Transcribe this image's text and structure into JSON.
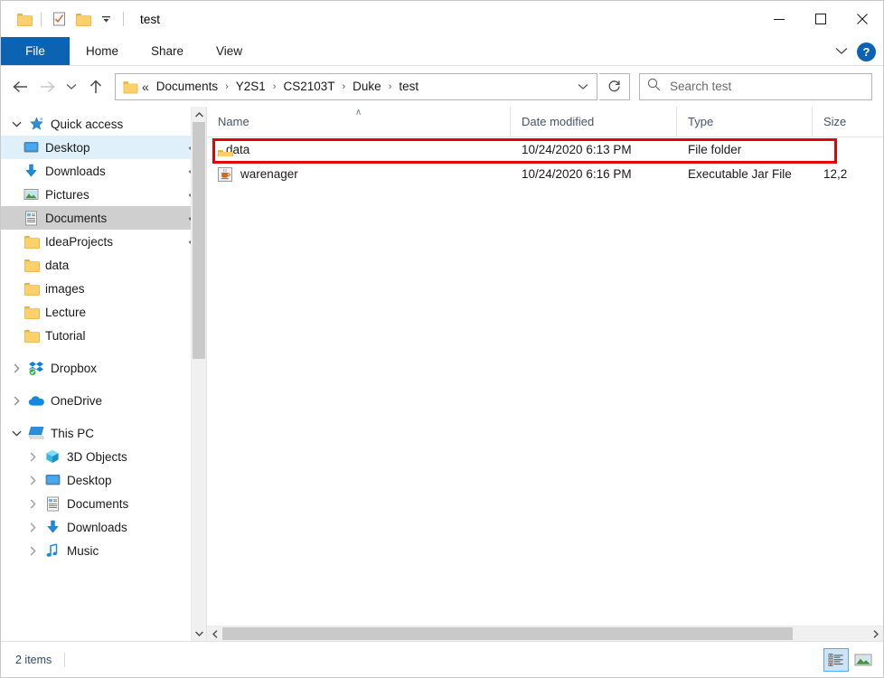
{
  "window": {
    "title": "test",
    "quick_access_toolbar": [
      {
        "name": "folder-icon",
        "label": "Properties folder"
      },
      {
        "name": "properties-icon",
        "label": "Properties"
      },
      {
        "name": "new-folder-icon",
        "label": "New folder"
      },
      {
        "name": "customize-dropdown-icon",
        "label": "Customize Quick Access Toolbar"
      }
    ],
    "controls": {
      "minimize": "─",
      "maximize": "□",
      "close": "✕"
    }
  },
  "ribbon": {
    "tabs": [
      {
        "label": "File",
        "active": true
      },
      {
        "label": "Home",
        "active": false
      },
      {
        "label": "Share",
        "active": false
      },
      {
        "label": "View",
        "active": false
      }
    ],
    "expand_icon": "∨",
    "help_label": "?"
  },
  "navigation": {
    "back": "←",
    "forward": "→",
    "recent": "∨",
    "up": "↑",
    "refresh": "⟳",
    "breadcrumb_prefix": "«",
    "breadcrumb": [
      "Documents",
      "Y2S1",
      "CS2103T",
      "Duke",
      "test"
    ],
    "breadcrumb_separator": "›",
    "breadcrumb_dropdown": "∨"
  },
  "search": {
    "placeholder": "Search test",
    "value": "",
    "icon": "search-icon"
  },
  "sidebar": {
    "groups": [
      {
        "label": "Quick access",
        "icon": "star-pin-icon",
        "expanded": true,
        "chevron": "∨",
        "items": [
          {
            "label": "Desktop",
            "icon": "desktop-icon",
            "pinned": true,
            "state": "hovered"
          },
          {
            "label": "Downloads",
            "icon": "download-icon",
            "pinned": true,
            "state": "normal"
          },
          {
            "label": "Pictures",
            "icon": "pictures-icon",
            "pinned": true,
            "state": "normal"
          },
          {
            "label": "Documents",
            "icon": "documents-icon",
            "pinned": true,
            "state": "selected"
          },
          {
            "label": "IdeaProjects",
            "icon": "folder-icon",
            "pinned": true,
            "state": "normal"
          },
          {
            "label": "data",
            "icon": "folder-icon",
            "pinned": false,
            "state": "normal"
          },
          {
            "label": "images",
            "icon": "folder-icon",
            "pinned": false,
            "state": "normal"
          },
          {
            "label": "Lecture",
            "icon": "folder-icon",
            "pinned": false,
            "state": "normal"
          },
          {
            "label": "Tutorial",
            "icon": "folder-icon",
            "pinned": false,
            "state": "normal"
          }
        ]
      },
      {
        "label": "Dropbox",
        "icon": "dropbox-icon",
        "expanded": false,
        "chevron": "›",
        "items": []
      },
      {
        "label": "OneDrive",
        "icon": "onedrive-icon",
        "expanded": false,
        "chevron": "›",
        "items": []
      },
      {
        "label": "This PC",
        "icon": "this-pc-icon",
        "expanded": true,
        "chevron": "∨",
        "items": [
          {
            "label": "3D Objects",
            "icon": "3d-objects-icon",
            "chevron": "›"
          },
          {
            "label": "Desktop",
            "icon": "desktop-icon",
            "chevron": "›"
          },
          {
            "label": "Documents",
            "icon": "documents-icon",
            "chevron": "›"
          },
          {
            "label": "Downloads",
            "icon": "download-icon",
            "chevron": "›"
          },
          {
            "label": "Music",
            "icon": "music-icon",
            "chevron": "›"
          }
        ]
      }
    ],
    "scroll": {
      "up": "∧",
      "down": "∨"
    }
  },
  "file_list": {
    "columns": [
      {
        "key": "name",
        "label": "Name",
        "sorted": "asc",
        "caret": "∧"
      },
      {
        "key": "date",
        "label": "Date modified",
        "sorted": "",
        "caret": ""
      },
      {
        "key": "type",
        "label": "Type",
        "sorted": "",
        "caret": ""
      },
      {
        "key": "size",
        "label": "Size",
        "sorted": "",
        "caret": ""
      }
    ],
    "rows": [
      {
        "name": "data",
        "icon": "folder-icon",
        "date": "10/24/2020 6:13 PM",
        "type": "File folder",
        "size": "",
        "highlighted": true
      },
      {
        "name": "warenager",
        "icon": "jar-file-icon",
        "date": "10/24/2020 6:16 PM",
        "type": "Executable Jar File",
        "size": "12,2",
        "highlighted": false
      }
    ],
    "h_scroll": {
      "left": "‹",
      "right": "›"
    }
  },
  "status_bar": {
    "item_count": "2 items",
    "view_buttons": [
      {
        "name": "details-view-button",
        "active": true,
        "label": "Details view"
      },
      {
        "name": "large-icons-view-button",
        "active": false,
        "label": "Large icons view"
      }
    ]
  },
  "colors": {
    "accent": "#0b63b2",
    "highlight_red": "#e60000",
    "selection_gray": "#cfcfcf",
    "hover_blue": "#dff0fb",
    "folder_yellow": "#fcd06b"
  }
}
